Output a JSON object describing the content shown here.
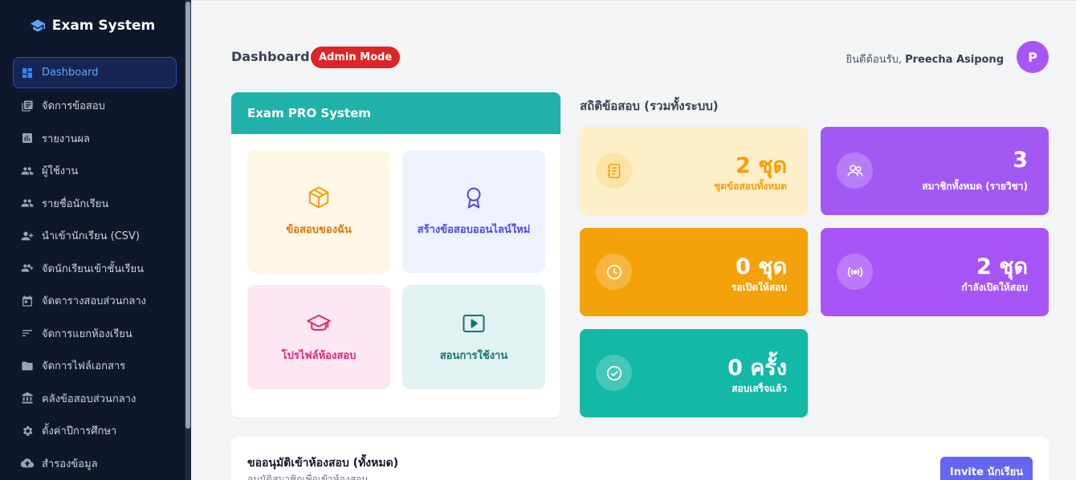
{
  "sidebar": {
    "brand": "Exam System",
    "items": [
      {
        "label": "Dashboard",
        "icon": "dashboard-icon"
      },
      {
        "label": "จัดการข้อสอบ",
        "icon": "library-icon"
      },
      {
        "label": "รายงานผล",
        "icon": "report-icon"
      },
      {
        "label": "ผู้ใช้งาน",
        "icon": "users-icon"
      },
      {
        "label": "รายชื่อนักเรียน",
        "icon": "users-icon"
      },
      {
        "label": "นำเข้านักเรียน (CSV)",
        "icon": "user-add-icon"
      },
      {
        "label": "จัดนักเรียนเข้าชั้นเรียน",
        "icon": "user-group-add-icon"
      },
      {
        "label": "จัดตารางสอบส่วนกลาง",
        "icon": "calendar-icon"
      },
      {
        "label": "จัดการแยกห้องเรียน",
        "icon": "sort-icon"
      },
      {
        "label": "จัดการไฟล์เอกสาร",
        "icon": "folder-icon"
      },
      {
        "label": "คลังข้อสอบส่วนกลาง",
        "icon": "bank-icon"
      },
      {
        "label": "ตั้งค่าปีการศึกษา",
        "icon": "gear-icon"
      },
      {
        "label": "สำรองข้อมูล",
        "icon": "cloud-upload-icon"
      }
    ]
  },
  "header": {
    "title": "Dashboard",
    "mode_badge": "Admin Mode",
    "welcome_prefix": "ยินดีต้อนรับ,",
    "user_name": "Preecha Asipong",
    "avatar_letter": "P"
  },
  "pro_panel": {
    "title": "Exam PRO System",
    "tiles": [
      {
        "label": "ข้อสอบของฉัน",
        "icon": "box-icon"
      },
      {
        "label": "สร้างข้อสอบออนไลน์ใหม่",
        "icon": "award-icon"
      },
      {
        "label": "โปรไฟล์ห้องสอบ",
        "icon": "graduation-cap-icon"
      },
      {
        "label": "สอนการใช้งาน",
        "icon": "play-icon"
      }
    ]
  },
  "stats": {
    "title": "สถิติข้อสอบ (รวมทั้งระบบ)",
    "cards": [
      {
        "value": "2 ชุด",
        "label": "ชุดข้อสอบทั้งหมด",
        "icon": "notebook-icon",
        "color": "#fdefc8"
      },
      {
        "value": "3",
        "label": "สมาชิกทั้งหมด (รายวิชา)",
        "icon": "people-icon",
        "color": "#a259f4"
      },
      {
        "value": "0 ชุด",
        "label": "รอเปิดให้สอบ",
        "icon": "clock-icon",
        "color": "#f4a20c"
      },
      {
        "value": "2 ชุด",
        "label": "กำลังเปิดให้สอบ",
        "icon": "broadcast-icon",
        "color": "#a855f7"
      },
      {
        "value": "0 ครั้ง",
        "label": "สอบเสร็จแล้ว",
        "icon": "check-circle-icon",
        "color": "#14b8a6"
      }
    ]
  },
  "pending": {
    "title": "ขออนุมัติเข้าห้องสอบ (ทั้งหมด)",
    "subtitle": "อนุมัติสมาชิกเพื่อเข้าห้องสอบ",
    "invite_label": "Invite นักเรียน"
  }
}
